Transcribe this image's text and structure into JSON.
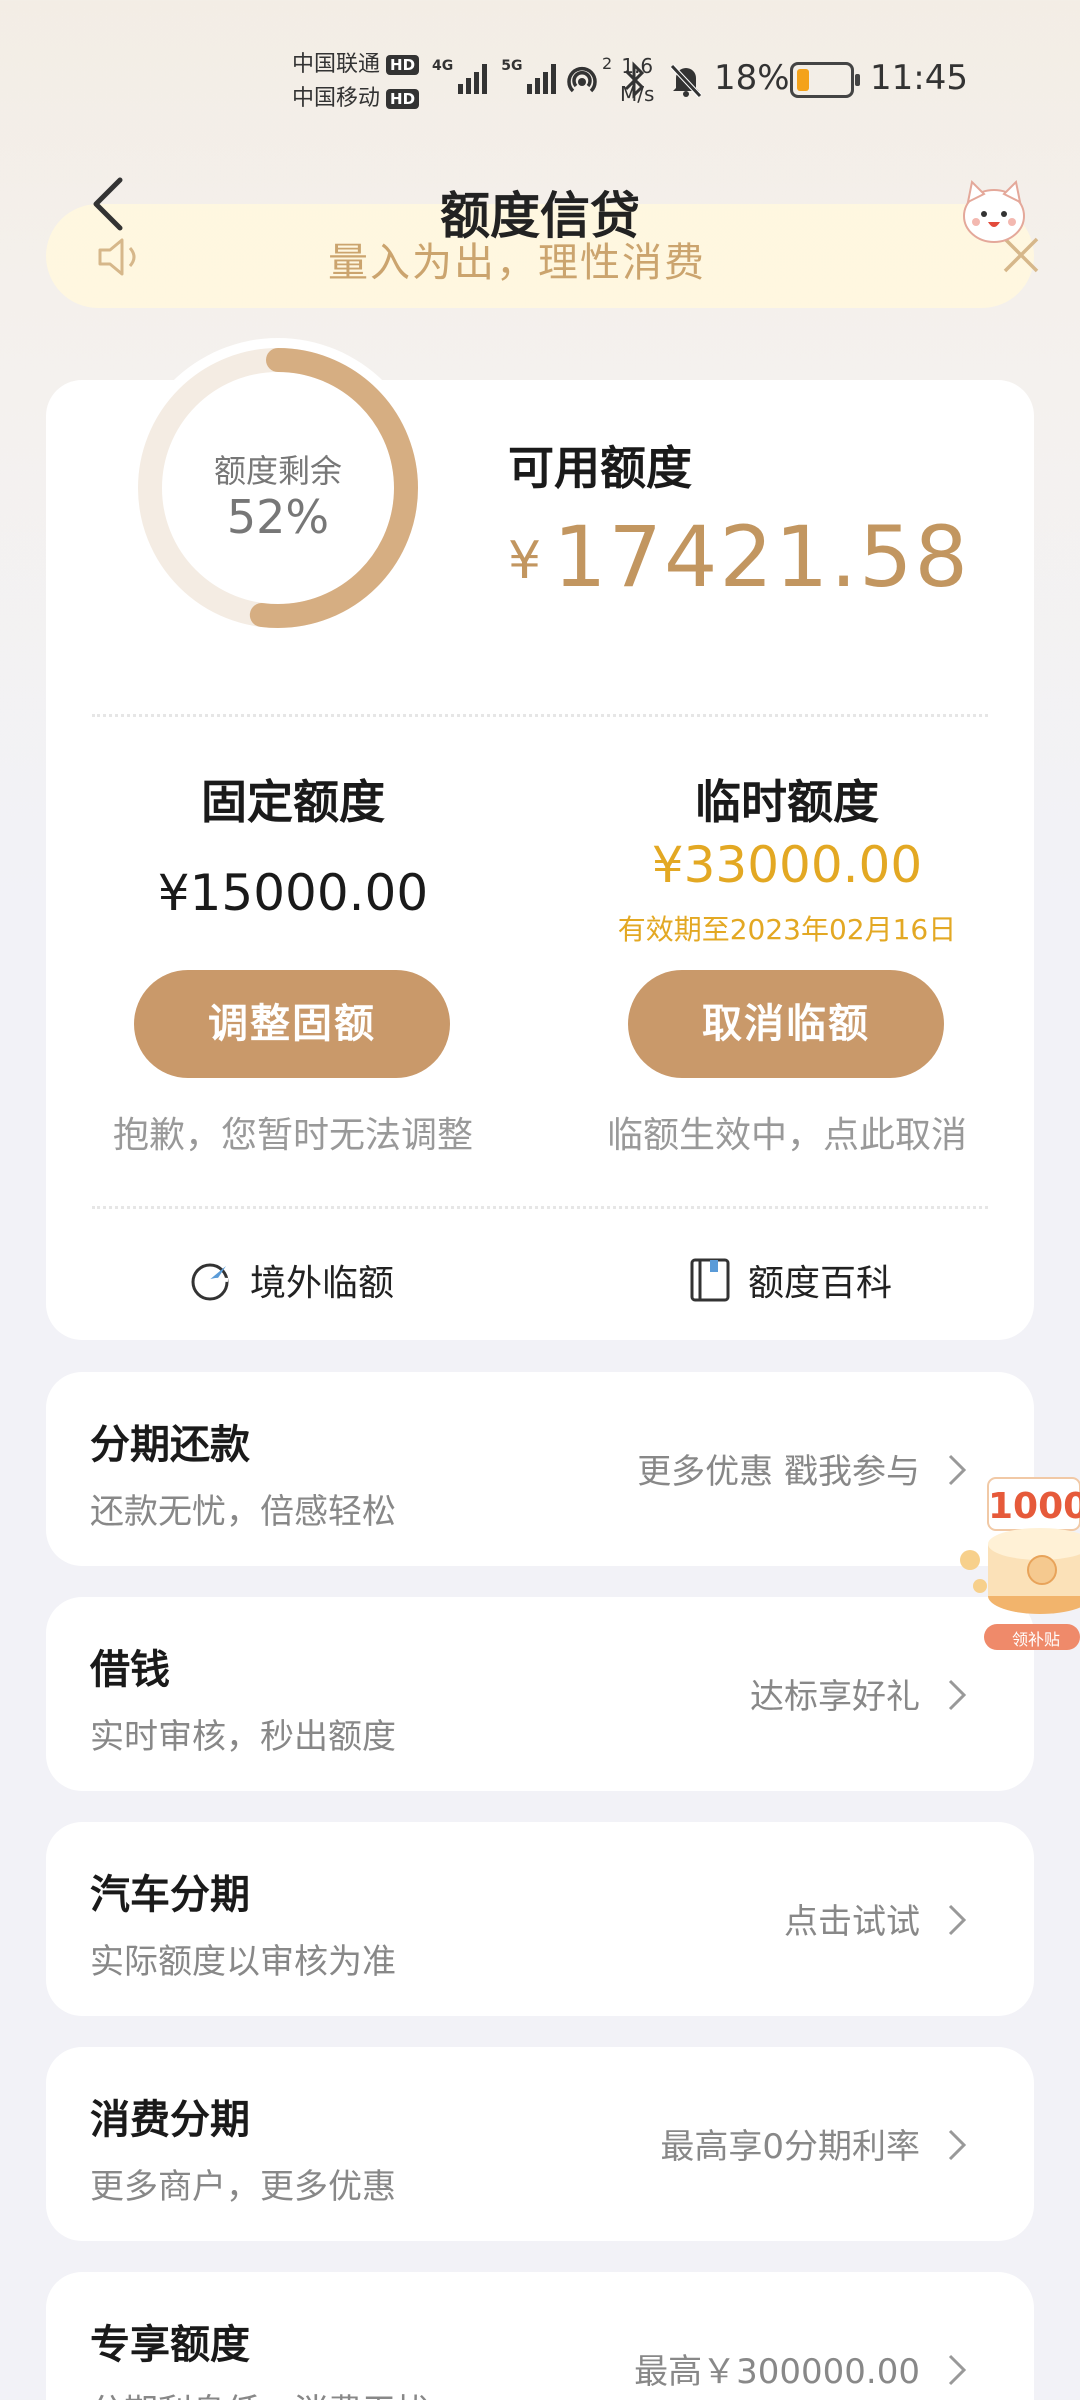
{
  "status_bar": {
    "carrier_1": "中国联通",
    "carrier_2": "中国移动",
    "hd": "HD",
    "net_1": "4G",
    "net_2": "5G",
    "hotspot_sup": "2",
    "speed_value": "1.6",
    "speed_unit": "M/s",
    "battery": "18%",
    "time": "11:45"
  },
  "nav": {
    "title": "额度信贷"
  },
  "notice": {
    "text": "量入为出，理性消费"
  },
  "credit": {
    "ring_label": "额度剩余",
    "ring_percent_text": "52%",
    "ring_percent": 52,
    "available_label": "可用额度",
    "currency": "¥",
    "available_amount": "17421.58",
    "fixed": {
      "title": "固定额度",
      "amount": "¥15000.00",
      "button": "调整固额",
      "note": "抱歉，您暂时无法调整"
    },
    "temporary": {
      "title": "临时额度",
      "amount": "¥33000.00",
      "valid": "有效期至2023年02月16日",
      "button": "取消临额",
      "note": "临额生效中，点此取消"
    },
    "links": {
      "overseas": "境外临额",
      "wiki": "额度百科"
    }
  },
  "list": [
    {
      "title": "分期还款",
      "subtitle": "还款无忧，倍感轻松",
      "right": "更多优惠 戳我参与"
    },
    {
      "title": "借钱",
      "subtitle": "实时审核，秒出额度",
      "right": "达标享好礼"
    },
    {
      "title": "汽车分期",
      "subtitle": "实际额度以审核为准",
      "right": "点击试试"
    },
    {
      "title": "消费分期",
      "subtitle": "更多商户，更多优惠",
      "right": "最高享0分期利率"
    },
    {
      "title": "专享额度",
      "subtitle": "分期利息低，消费无忧",
      "right": "最高￥300000.00"
    }
  ],
  "promo": {
    "amount": "1000",
    "tag": "领补贴"
  },
  "colors": {
    "accent": "#c9996a",
    "gold_text": "#c29660",
    "temp_yellow": "#e3a823"
  }
}
